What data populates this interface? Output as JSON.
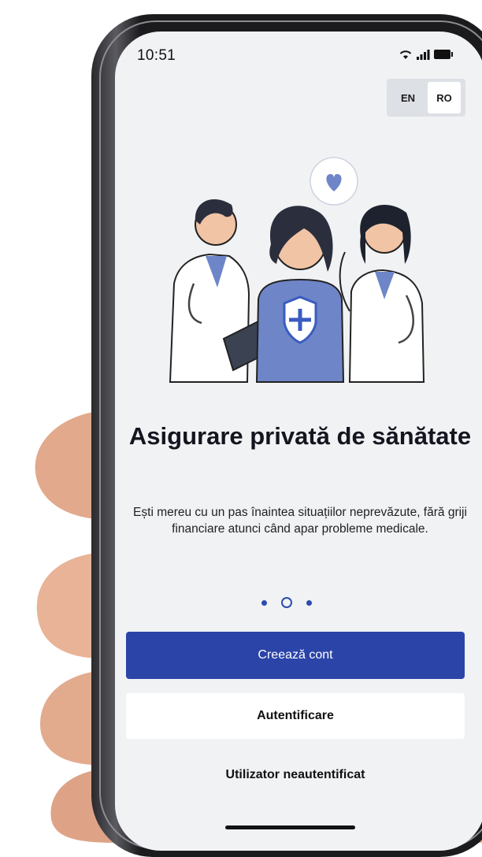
{
  "status_bar": {
    "time": "10:51"
  },
  "language": {
    "options": [
      "EN",
      "RO"
    ],
    "selected": "RO"
  },
  "onboarding": {
    "title": "Asigurare privată de sănătate",
    "description": "Ești mereu cu un pas înaintea situațiilor neprevăzute, fără griji financiare atunci când apar probleme medicale.",
    "pager": {
      "total": 3,
      "current": 2
    }
  },
  "actions": {
    "create_account": "Creează cont",
    "login": "Autentificare",
    "guest": "Utilizator neautentificat"
  },
  "colors": {
    "primary": "#2b44a8",
    "screen_bg": "#f0f2f4",
    "illustration_accent": "#6e85c8"
  }
}
